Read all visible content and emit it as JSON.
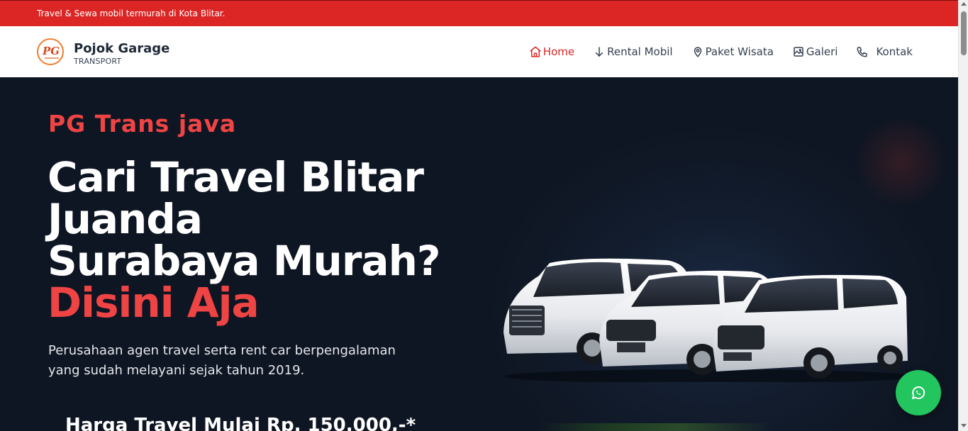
{
  "topbar": {
    "text": "Travel & Sewa mobil termurah di Kota Blitar."
  },
  "brand": {
    "logo_text": "PG",
    "name": "Pojok Garage",
    "subtitle": "TRANSPORT"
  },
  "nav": {
    "items": [
      {
        "label": "Home",
        "icon": "home-icon",
        "active": true
      },
      {
        "label": "Rental Mobil",
        "icon": "arrow-down-icon",
        "active": false
      },
      {
        "label": "Paket Wisata",
        "icon": "map-pin-icon",
        "active": false
      },
      {
        "label": "Galeri",
        "icon": "image-icon",
        "active": false
      },
      {
        "label": "Kontak",
        "icon": "phone-icon",
        "active": false
      }
    ]
  },
  "hero": {
    "eyebrow": "PG Trans java",
    "title_line1": "Cari Travel Blitar",
    "title_line2": "Juanda",
    "title_line3": "Surabaya Murah?",
    "title_accent": "Disini Aja",
    "description": "Perusahaan agen travel serta rent car berpengalaman yang sudah melayani sejak tahun 2019.",
    "price": "Harga Travel Mulai Rp. 150.000,-*"
  },
  "whatsapp": {
    "icon": "whatsapp-icon"
  },
  "colors": {
    "accent": "#dc2626",
    "hero_bg": "#0f1623",
    "whatsapp": "#22c55e"
  }
}
